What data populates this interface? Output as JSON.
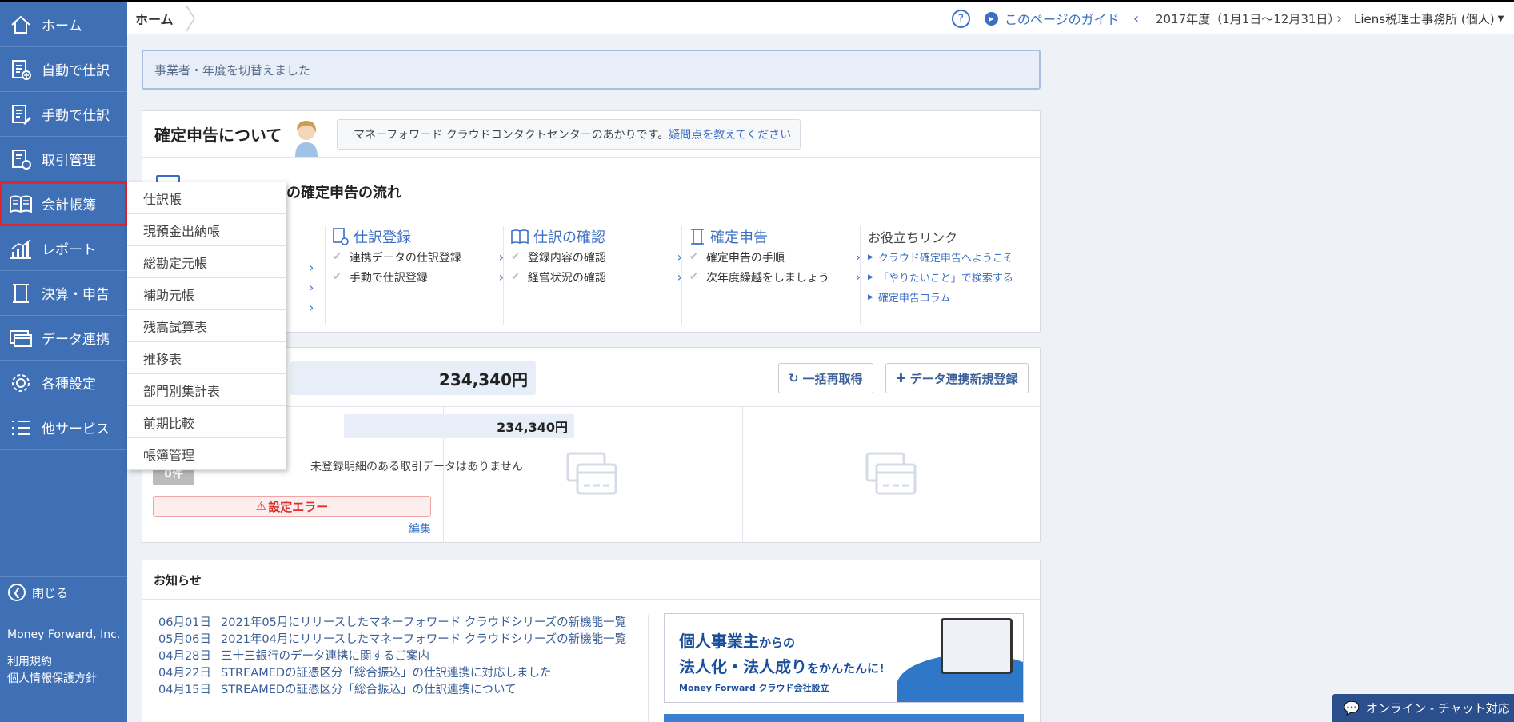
{
  "sidebar": {
    "items": [
      {
        "label": "ホーム",
        "icon": "home-icon"
      },
      {
        "label": "自動で仕訳",
        "icon": "auto-journal-icon"
      },
      {
        "label": "手動で仕訳",
        "icon": "manual-journal-icon"
      },
      {
        "label": "取引管理",
        "icon": "transaction-icon"
      },
      {
        "label": "会計帳簿",
        "icon": "book-icon"
      },
      {
        "label": "レポート",
        "icon": "report-icon"
      },
      {
        "label": "決算・申告",
        "icon": "settlement-icon"
      },
      {
        "label": "データ連携",
        "icon": "data-link-icon"
      },
      {
        "label": "各種設定",
        "icon": "gear-icon"
      },
      {
        "label": "他サービス",
        "icon": "list-icon"
      }
    ],
    "close_label": "閉じる",
    "company": "Money Forward, Inc.",
    "terms": "利用規約",
    "privacy": "個人情報保護方針"
  },
  "flyout": {
    "items": [
      "仕訳帳",
      "現預金出納帳",
      "総勘定元帳",
      "補助元帳",
      "残高試算表",
      "推移表",
      "部門別集計表",
      "前期比較",
      "帳簿管理"
    ]
  },
  "header": {
    "breadcrumb": "ホーム",
    "guide": "このページのガイド",
    "year": "2017年度（1月1日〜12月31日）",
    "office": "Liens税理士事務所 (個人)"
  },
  "notice": "事業者・年度を切替えました",
  "tax_card": {
    "title": "確定申告について",
    "bubble_text": "マネーフォワード クラウドコンタクトセンターのあかりです。",
    "bubble_link": "疑問点を教えてください",
    "flow_title": "の確定申告の流れ",
    "columns": [
      {
        "title": "仕訳登録",
        "items": [
          "連携データの仕訳登録",
          "手動で仕訳登録"
        ]
      },
      {
        "title": "仕訳の確認",
        "items": [
          "登録内容の確認",
          "経営状況の確認"
        ]
      },
      {
        "title": "確定申告",
        "items": [
          "確定申告の手順",
          "次年度繰越をしましょう"
        ]
      }
    ],
    "links_title": "お役立ちリンク",
    "links": [
      "クラウド確定申告へようこそ",
      "「やりたいこと」で検索する",
      "確定申告コラム"
    ]
  },
  "balance_card": {
    "total": "234,340円",
    "refresh_button": "一括再取得",
    "new_link_button": "データ連携新規登録",
    "sub_balance": "234,340円",
    "count_badge": "0件",
    "no_data": "未登録明細のある取引データはありません",
    "error": "設定エラー",
    "edit": "編集"
  },
  "news": {
    "title": "お知らせ",
    "items": [
      {
        "date": "06月01日",
        "text": "2021年05月にリリースしたマネーフォワード クラウドシリーズの新機能一覧"
      },
      {
        "date": "05月06日",
        "text": "2021年04月にリリースしたマネーフォワード クラウドシリーズの新機能一覧"
      },
      {
        "date": "04月28日",
        "text": "三十三銀行のデータ連携に関するご案内"
      },
      {
        "date": "04月22日",
        "text": "STREAMEDの証憑区分「総合振込」の仕訳連携に対応しました"
      },
      {
        "date": "04月15日",
        "text": "STREAMEDの証憑区分「総合振込」の仕訳連携について"
      }
    ],
    "banner": {
      "line1_a": "個人事業主",
      "line1_b": "からの",
      "line2_a": "法人化・法人成り",
      "line2_b": "をかんたんに!",
      "line3": "Money Forward クラウド会社設立"
    }
  },
  "chat_label": "オンライン - チャット対応",
  "colors": {
    "sidebar": "#3f6fb5",
    "accent": "#3a6fc4",
    "error": "#d9302e",
    "active_outline": "#e2232d"
  }
}
